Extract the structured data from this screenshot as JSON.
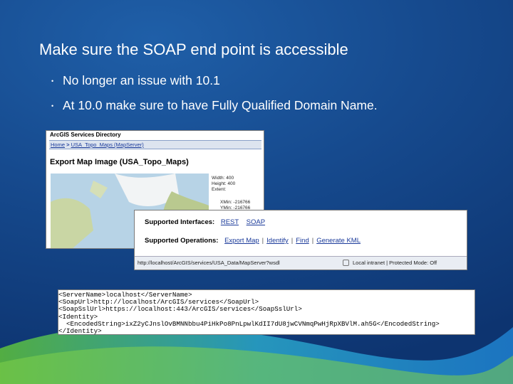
{
  "slide": {
    "title": "Make sure the SOAP end point is accessible",
    "bullets": [
      "No longer an issue with 10.1",
      "At 10.0 make sure to have Fully Qualified Domain Name."
    ],
    "colors": {
      "background": "#164a8e",
      "text": "#ffffff",
      "link": "#1a3a9a"
    }
  },
  "services_directory": {
    "title": "ArcGIS Services Directory",
    "breadcrumb": [
      "Home",
      "USA_Topo_Maps (MapServer)"
    ],
    "breadcrumb_sep": " > ",
    "heading": "Export Map Image (USA_Topo_Maps)",
    "props": [
      "Width: 400",
      "Height: 400",
      "Extent:",
      "XMin: -216766",
      "YMin: -216766"
    ]
  },
  "service_info": {
    "interfaces_label": "Supported Interfaces:",
    "interfaces": [
      "REST",
      "SOAP"
    ],
    "operations_label": "Supported Operations:",
    "operations": [
      "Export Map",
      "Identify",
      "Find",
      "Generate KML"
    ],
    "status_url": "http://localhost/ArcGIS/services/USA_Data/MapServer?wsdl",
    "status_zone": "Local intranet | Protected Mode: Off"
  },
  "xml_snippet": {
    "lines": [
      "<ServerName>localhost</ServerName>",
      "<SoapUrl>http://localhost/ArcGIS/services</SoapUrl>",
      "<SoapSslUrl>https://localhost:443/ArcGIS/services</SoapSslUrl>",
      "<Identity>",
      "  <EncodedString>ixZ2yCJnslOvBMNNbbu4PiHkPo8PnLpwlKdII7dU8jwCVNmqPwHjRpXBVlM.ah5G</EncodedString>",
      "</Identity>"
    ]
  }
}
